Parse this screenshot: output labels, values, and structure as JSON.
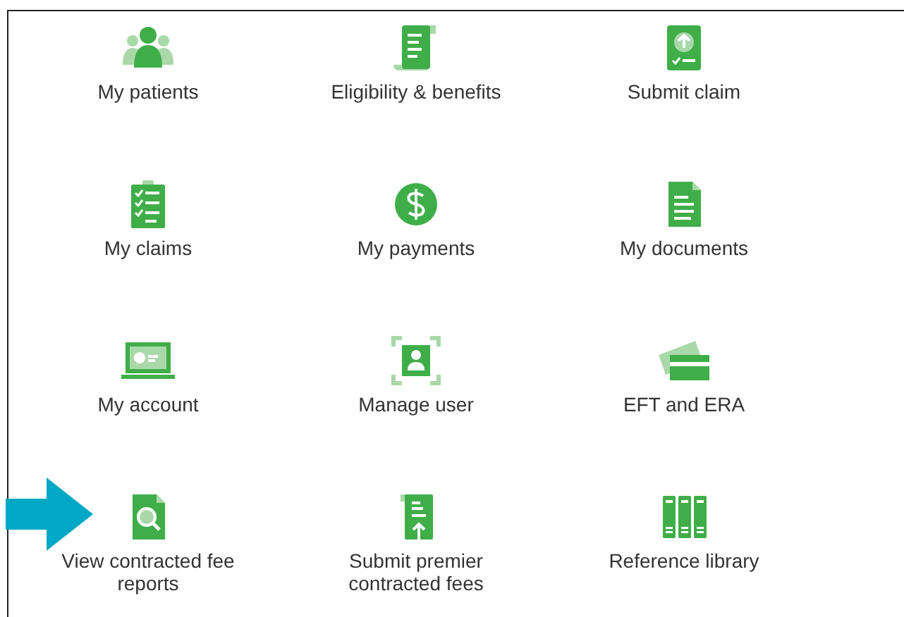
{
  "tiles": [
    {
      "label": "My patients",
      "kind": "patients",
      "pointed": false
    },
    {
      "label": "Eligibility & benefits",
      "kind": "scroll",
      "pointed": false
    },
    {
      "label": "Submit claim",
      "kind": "submit",
      "pointed": false
    },
    {
      "label": "My claims",
      "kind": "clipboard",
      "pointed": false
    },
    {
      "label": "My payments",
      "kind": "dollar",
      "pointed": false
    },
    {
      "label": "My documents",
      "kind": "document",
      "pointed": false
    },
    {
      "label": "My account",
      "kind": "laptop",
      "pointed": false
    },
    {
      "label": "Manage user",
      "kind": "user",
      "pointed": false
    },
    {
      "label": "EFT and ERA",
      "kind": "cards",
      "pointed": false
    },
    {
      "label": "View contracted fee reports",
      "kind": "search-doc",
      "pointed": true
    },
    {
      "label": "Submit premier contracted fees",
      "kind": "upload-doc",
      "pointed": false
    },
    {
      "label": "Reference library",
      "kind": "binders",
      "pointed": false
    }
  ]
}
